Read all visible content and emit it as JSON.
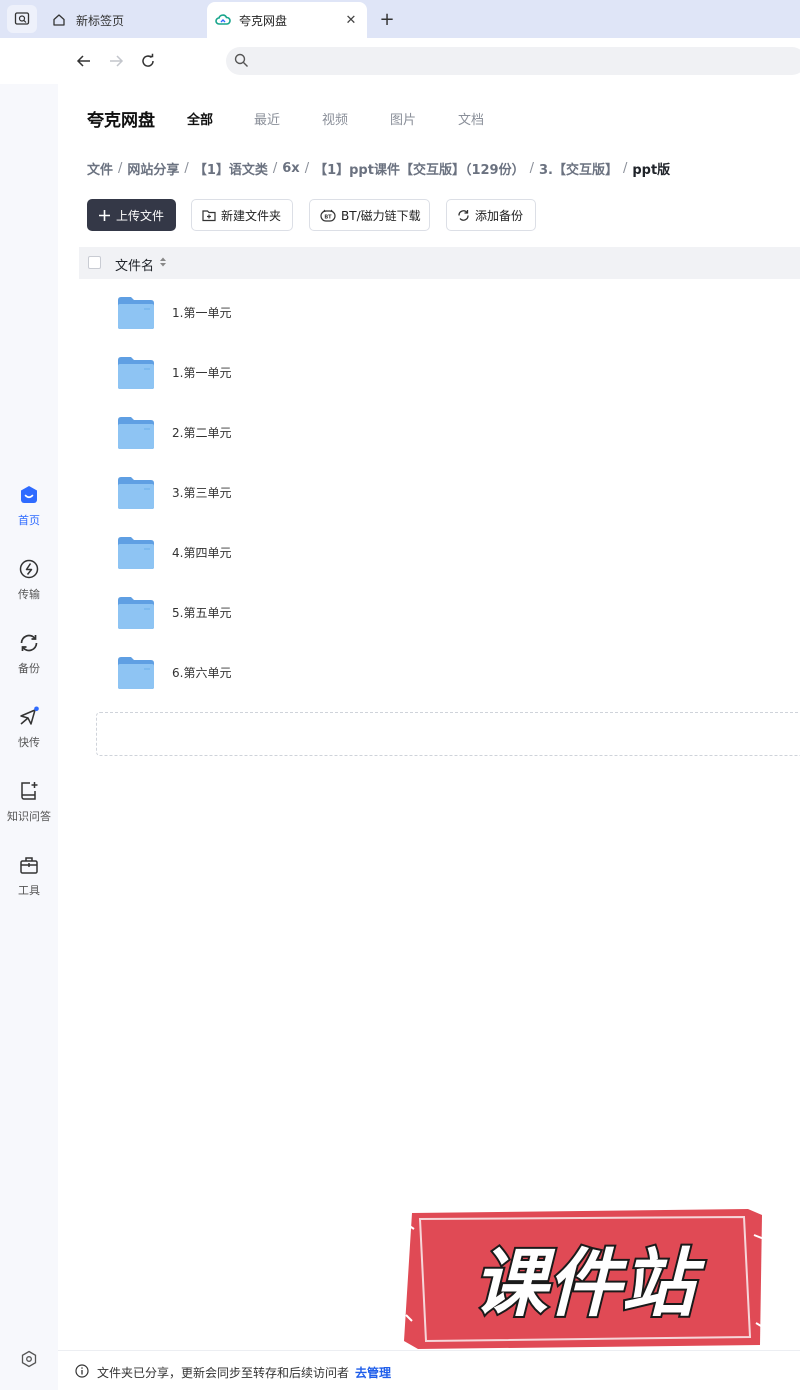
{
  "browser": {
    "tabs": [
      {
        "label": "新标签页",
        "icon": "home-icon"
      },
      {
        "label": "夸克网盘",
        "icon": "cloud-icon"
      }
    ],
    "address": {
      "placeholder": ""
    }
  },
  "sidebar": {
    "items": [
      {
        "label": "首页",
        "icon": "home-face-icon"
      },
      {
        "label": "传输",
        "icon": "transfer-icon"
      },
      {
        "label": "备份",
        "icon": "sync-icon"
      },
      {
        "label": "快传",
        "icon": "send-icon"
      },
      {
        "label": "知识问答",
        "icon": "knowledge-icon"
      },
      {
        "label": "工具",
        "icon": "toolbox-icon"
      }
    ]
  },
  "app": {
    "brand": "夸克网盘",
    "tabs": [
      "全部",
      "最近",
      "视频",
      "图片",
      "文档"
    ],
    "breadcrumb": [
      "文件",
      "网站分享",
      "【1】语文类",
      "6x",
      "【1】ppt课件【交互版】（129份）",
      "3.【交互版】",
      "ppt版"
    ],
    "actions": {
      "upload": "上传文件",
      "new_folder": "新建文件夹",
      "bt": "BT/磁力链下载",
      "backup": "添加备份"
    },
    "table": {
      "col_name": "文件名"
    },
    "files": [
      {
        "name": "1.第一单元"
      },
      {
        "name": "1.第一单元"
      },
      {
        "name": "2.第二单元"
      },
      {
        "name": "3.第三单元"
      },
      {
        "name": "4.第四单元"
      },
      {
        "name": "5.第五单元"
      },
      {
        "name": "6.第六单元"
      }
    ],
    "footer": {
      "text": "文件夹已分享，更新会同步至转存和后续访问者",
      "link": "去管理"
    }
  },
  "watermark": {
    "text": "课件站"
  },
  "colors": {
    "accent": "#2f6bff",
    "upload_bg": "#343847",
    "watermark_red": "#e04a55",
    "folder_blue": "#7db8ef"
  }
}
